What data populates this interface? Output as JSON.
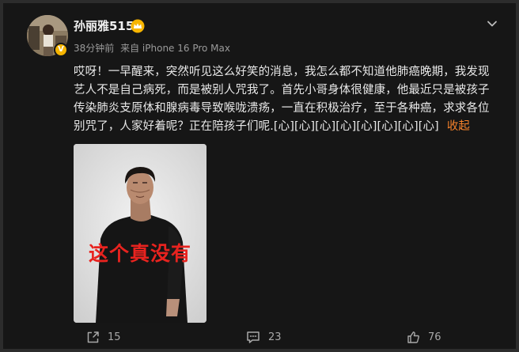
{
  "user": {
    "name": "孙丽雅515",
    "verified_badge": "V",
    "time_ago": "38分钟前",
    "source": "来自 iPhone 16 Pro Max"
  },
  "post": {
    "lines": [
      "哎呀！一早醒来，突然听见这么好笑的消息，我怎么都不知道他肺癌晚期，我发现",
      "艺人不是自己病死，而是被别人咒我了。首先小哥身体很健康，他最近只是被孩子",
      "传染肺炎支原体和腺病毒导致喉咙溃疡，一直在积极治疗，至于各种癌，求求各位",
      "别咒了，人家好着呢？正在陪孩子们呢.[心][心][心][心][心][心][心][心]"
    ],
    "collapse_label": "收起"
  },
  "image": {
    "caption": "这个真没有"
  },
  "actions": {
    "share_count": "15",
    "comment_count": "23",
    "like_count": "76"
  },
  "colors": {
    "background": "#161616",
    "accent": "#f5812a",
    "caption_red": "#e8231f"
  },
  "icons": [
    "more-icon",
    "crown-icon",
    "share-icon",
    "comment-icon",
    "like-icon"
  ]
}
